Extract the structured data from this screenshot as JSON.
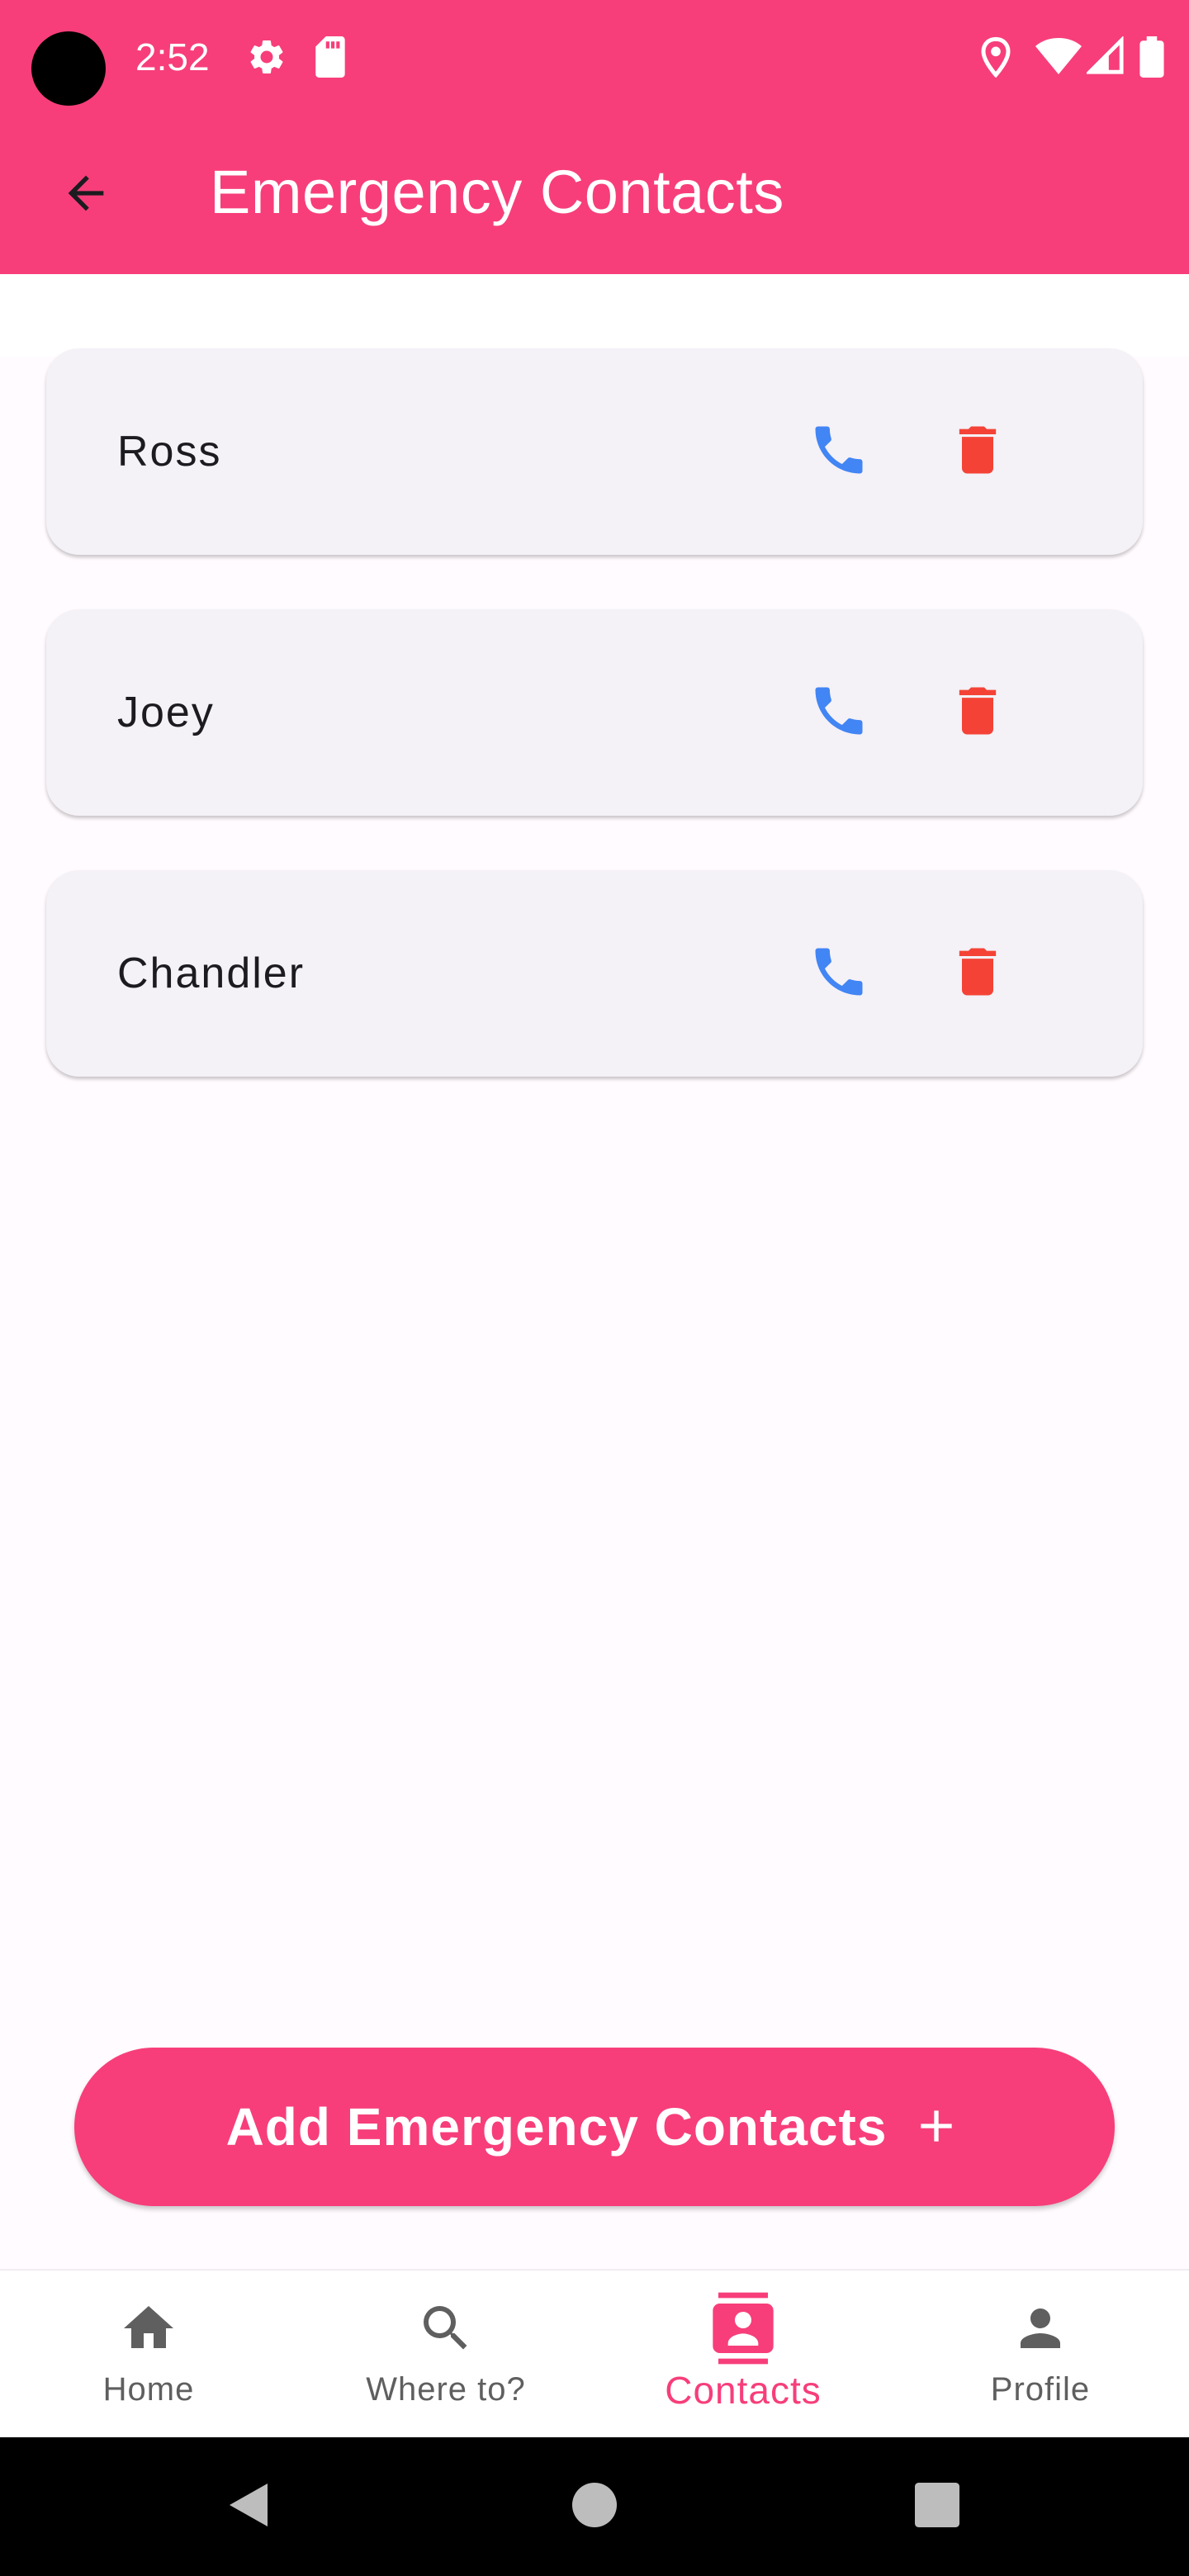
{
  "status_bar": {
    "time": "2:52",
    "icons_left": [
      "settings-icon",
      "sd-card-icon"
    ],
    "icons_right": [
      "location-icon",
      "wifi-icon",
      "signal-icon",
      "battery-icon"
    ]
  },
  "app_bar": {
    "title": "Emergency Contacts",
    "back_icon": "arrow-back-icon",
    "color": "#f73e7a"
  },
  "contacts": [
    {
      "name": "Ross"
    },
    {
      "name": "Joey"
    },
    {
      "name": "Chandler"
    }
  ],
  "contact_actions": {
    "call_icon": "phone-icon",
    "call_color": "#4285f4",
    "delete_icon": "trash-icon",
    "delete_color": "#f44336"
  },
  "add_button": {
    "label": "Add Emergency Contacts",
    "icon": "plus-icon"
  },
  "bottom_nav": {
    "items": [
      {
        "label": "Home",
        "icon": "home-icon"
      },
      {
        "label": "Where to?",
        "icon": "search-icon"
      },
      {
        "label": "Contacts",
        "icon": "contacts-icon",
        "active": true
      },
      {
        "label": "Profile",
        "icon": "person-icon"
      }
    ],
    "active_color": "#f73e7a"
  },
  "system_nav": [
    "back-triangle-icon",
    "home-circle-icon",
    "recents-square-icon"
  ]
}
